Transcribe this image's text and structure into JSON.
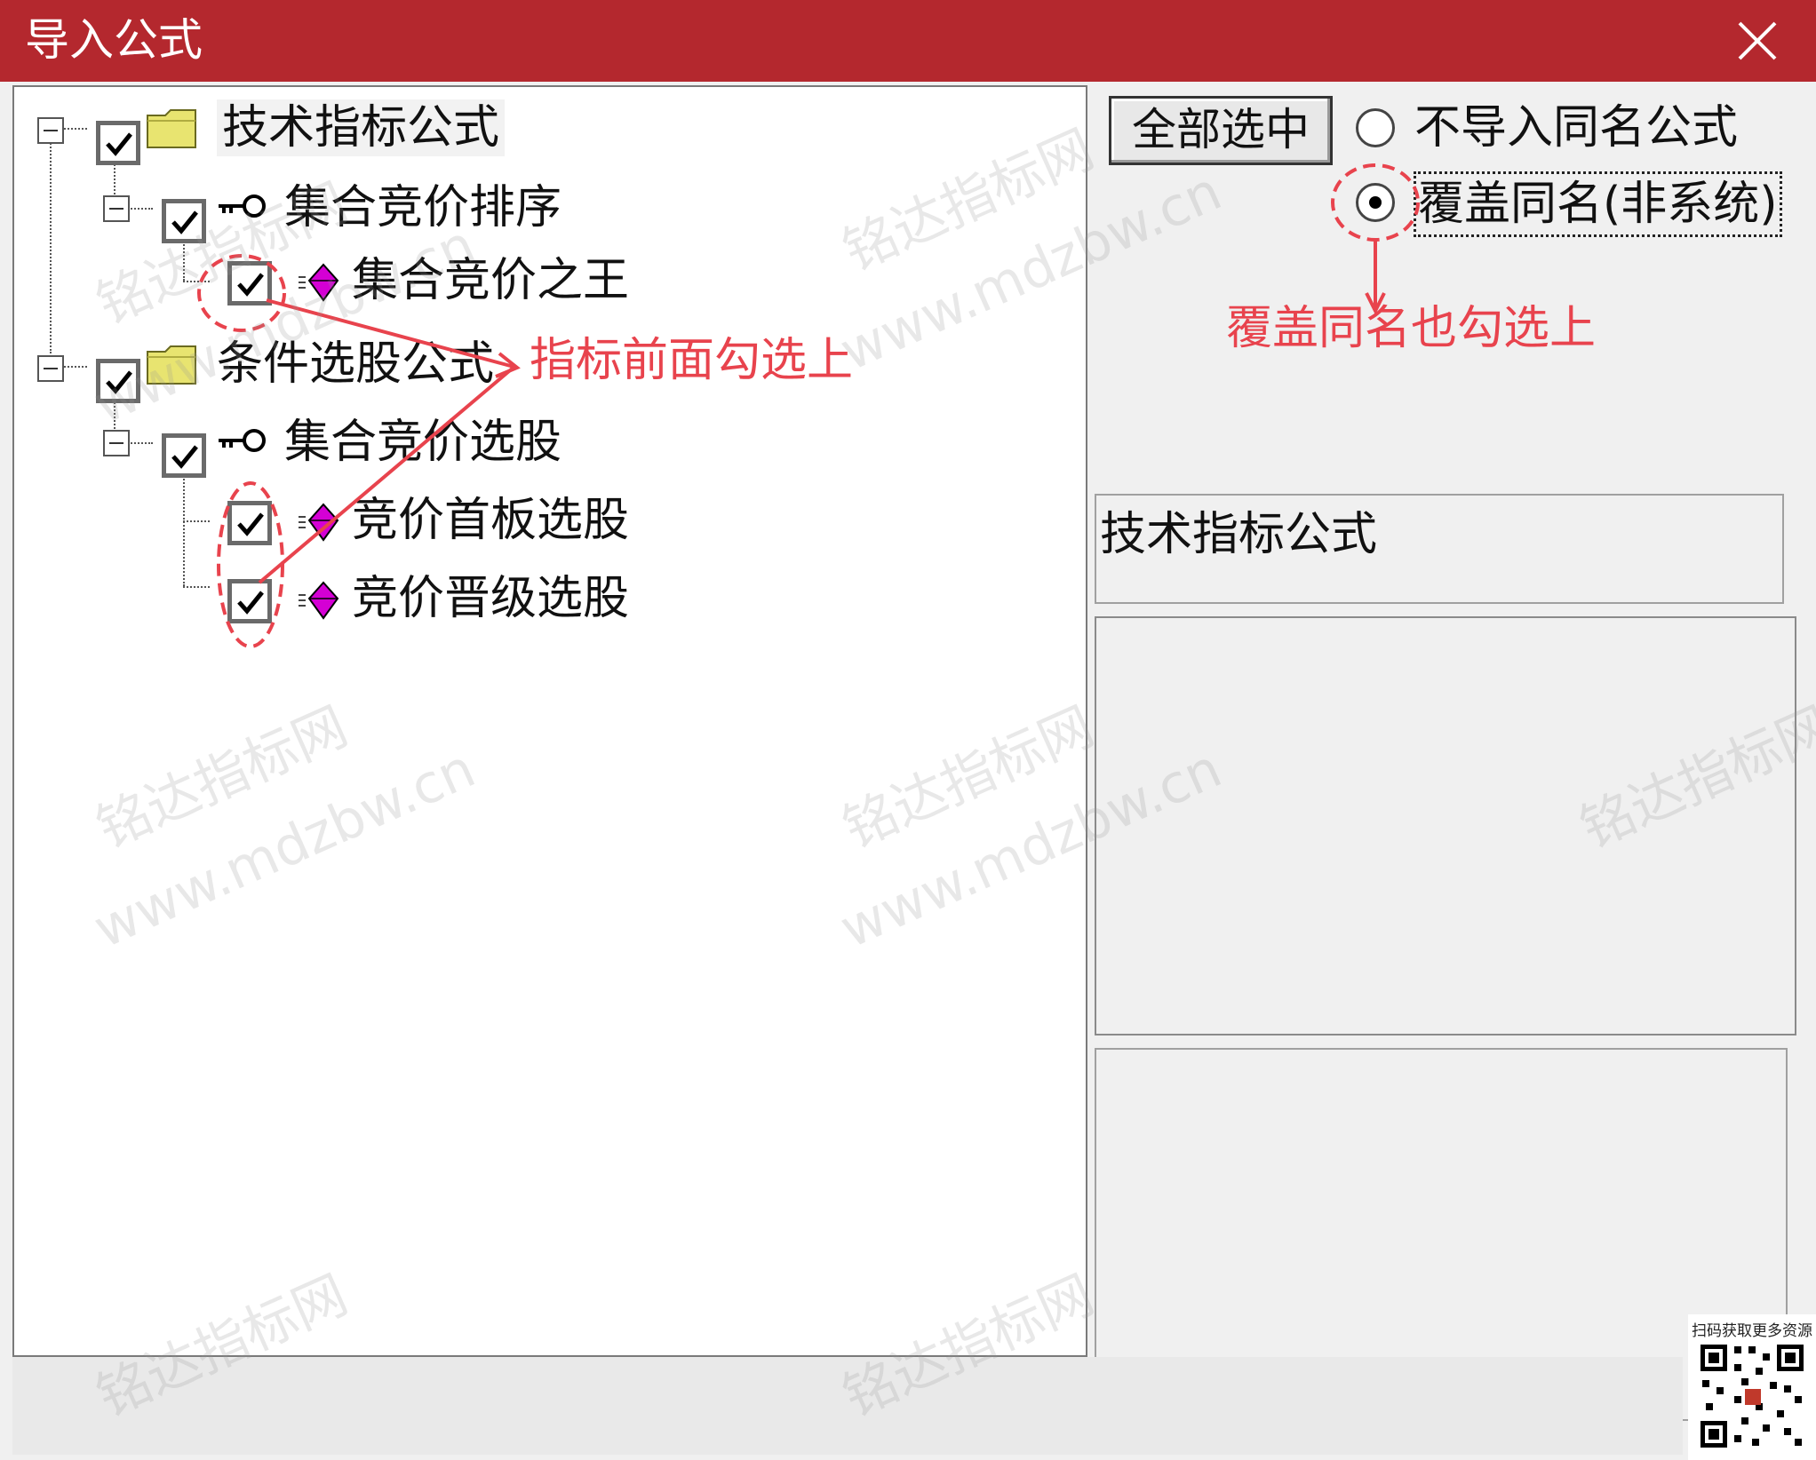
{
  "window": {
    "title": "导入公式"
  },
  "tree": {
    "nodes": [
      {
        "label": "技术指标公式"
      },
      {
        "label": "集合竞价排序"
      },
      {
        "label": "集合竞价之王"
      },
      {
        "label": "条件选股公式"
      },
      {
        "label": "集合竞价选股"
      },
      {
        "label": "竞价首板选股"
      },
      {
        "label": "竞价晋级选股"
      }
    ]
  },
  "controls": {
    "select_all_label": "全部选中",
    "radio_options": [
      {
        "label": "不导入同名公式",
        "selected": false
      },
      {
        "label": "覆盖同名(非系统)",
        "selected": true
      }
    ]
  },
  "info": {
    "category_label": "技术指标公式"
  },
  "annotations": {
    "tick_indicators": "指标前面勾选上",
    "tick_overwrite": "覆盖同名也勾选上",
    "color": "#e8434d"
  },
  "watermark": {
    "line1": "铭达指标网",
    "line2": "www.mdzbw.cn"
  },
  "qr": {
    "caption": "扫码获取更多资源"
  },
  "colors": {
    "titlebar": "#b4282e",
    "gem": "#d400d4",
    "folder": "#e8e470"
  }
}
